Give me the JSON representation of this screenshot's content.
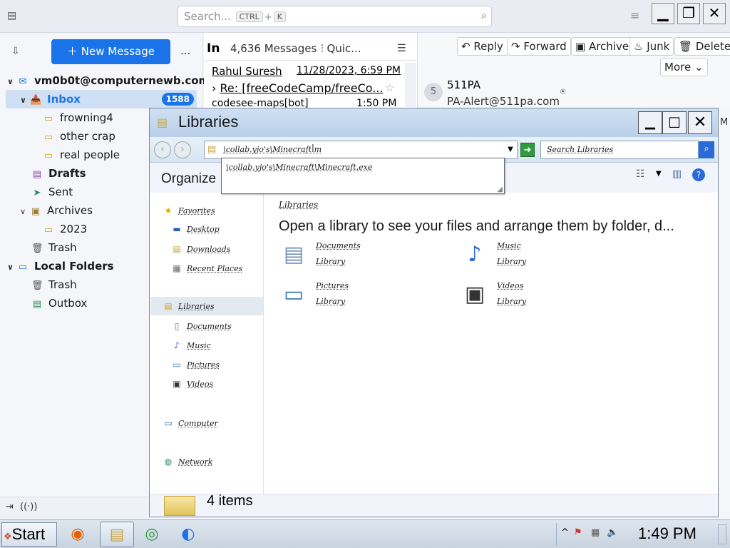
{
  "thunderbird": {
    "search_placeholder": "Search...",
    "search_kbd1": "CTRL",
    "search_plus": "+",
    "search_kbd2": "K",
    "new_message": "New Message",
    "more_dots": "...",
    "account": "vm0b0t@computernewb.com",
    "folders": {
      "inbox": "Inbox",
      "inbox_count": "1588",
      "frowning4": "frowning4",
      "other_crap": "other crap",
      "real_people": "real people",
      "drafts": "Drafts",
      "sent": "Sent",
      "archives": "Archives",
      "year": "2023",
      "trash": "Trash",
      "local_folders": "Local Folders",
      "local_trash": "Trash",
      "outbox": "Outbox"
    },
    "list": {
      "folder_abbrev": "In",
      "count": "4,636 Messages",
      "quick_filter": "Quic...",
      "row1_from": "Rahul Suresh",
      "row1_date": "11/28/2023, 6:59 PM",
      "row2_subject": "Re: [freeCodeCamp/freeCo...",
      "row3_from": "codesee-maps[bot]",
      "row3_time": "1:50 PM"
    },
    "reader": {
      "reply": "Reply",
      "forward": "Forward",
      "archive": "Archive",
      "junk": "Junk",
      "delete": "Delete",
      "more": "More",
      "avatar_letter": "5",
      "from_name": "511PA",
      "from_email": "PA-Alert@511pa.com",
      "tail_letter": "M"
    }
  },
  "explorer": {
    "title": "Libraries",
    "address_text": "\\collab.yjo's\\Minecraft.m",
    "autocomplete_item": "\\collab.yjo's\\Minecraft\\Minecraft.exe",
    "search_placeholder": "Search Libraries",
    "organize": "Organize",
    "nav": {
      "favorites": "Favorites",
      "desktop": "Desktop",
      "downloads": "Downloads",
      "recent": "Recent Places",
      "libraries": "Libraries",
      "documents": "Documents",
      "music": "Music",
      "pictures": "Pictures",
      "videos": "Videos",
      "computer": "Computer",
      "network": "Network"
    },
    "content": {
      "heading": "Libraries",
      "description": "Open a library to see your files and arrange them by folder, d...",
      "documents": "Documents",
      "music": "Music",
      "pictures": "Pictures",
      "videos": "Videos",
      "library_word": "Library"
    },
    "status": "4 items"
  },
  "taskbar": {
    "start": "Start",
    "clock": "1:49 PM",
    "tray_arrow": "^"
  },
  "colors": {
    "accent": "#1a73e8",
    "badge": "#1a73e8",
    "explorer_title": "#b9d0ea"
  }
}
